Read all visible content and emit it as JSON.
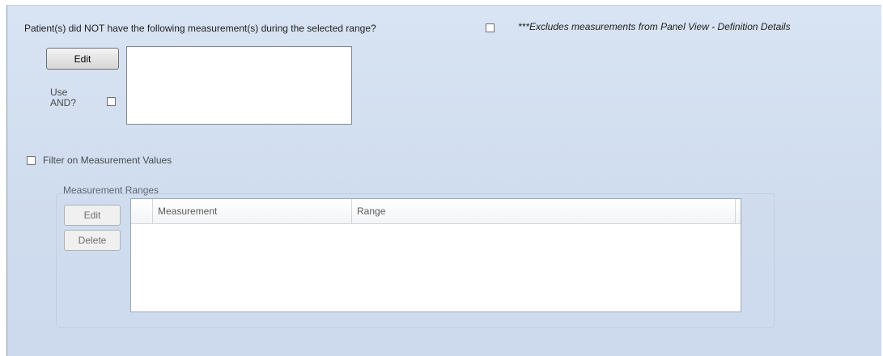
{
  "question": {
    "label": "Patient(s) did NOT have the following measurement(s) during the selected range?",
    "checked": false
  },
  "note": {
    "text": "***Excludes measurements from Panel View - Definition Details"
  },
  "measurements_selector": {
    "edit_label": "Edit",
    "use_and_label_line1": "Use",
    "use_and_label_line2": "AND?",
    "use_and_checked": false,
    "items": []
  },
  "filter": {
    "label": "Filter on Measurement Values",
    "checked": false
  },
  "ranges": {
    "title": "Measurement Ranges",
    "edit_label": "Edit",
    "delete_label": "Delete",
    "columns": [
      "Measurement",
      "Range"
    ],
    "rows": []
  }
}
